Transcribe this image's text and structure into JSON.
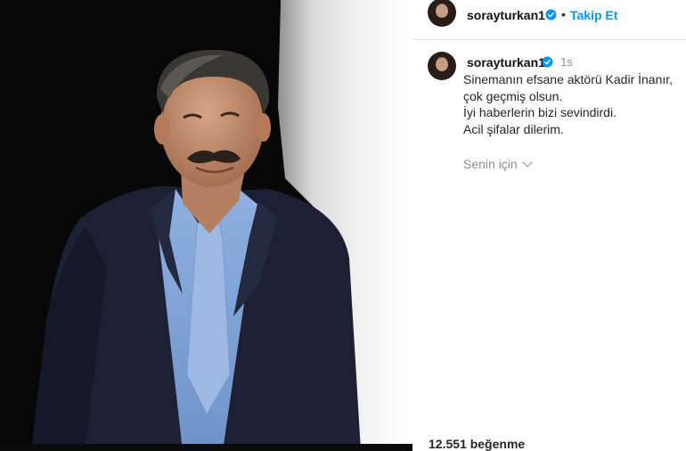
{
  "post": {
    "username": "sorayturkan1",
    "follow_label": "Takip Et",
    "separator": "•",
    "caption": {
      "time": "1s",
      "lines": [
        "Sinemanın efsane aktörü Kadir İnanır,",
        "çok geçmiş olsun.",
        "İyi haberlerin bizi sevindirdi.",
        "Acil şifalar dilerim."
      ]
    },
    "for_you_label": "Senin için",
    "likes_text": "12.551 beğenme",
    "icons": {
      "verified": "verified-badge-icon",
      "chevron": "chevron-down-icon"
    },
    "colors": {
      "accent": "#0095f6",
      "muted": "#8e8e8e",
      "text": "#262626"
    }
  }
}
